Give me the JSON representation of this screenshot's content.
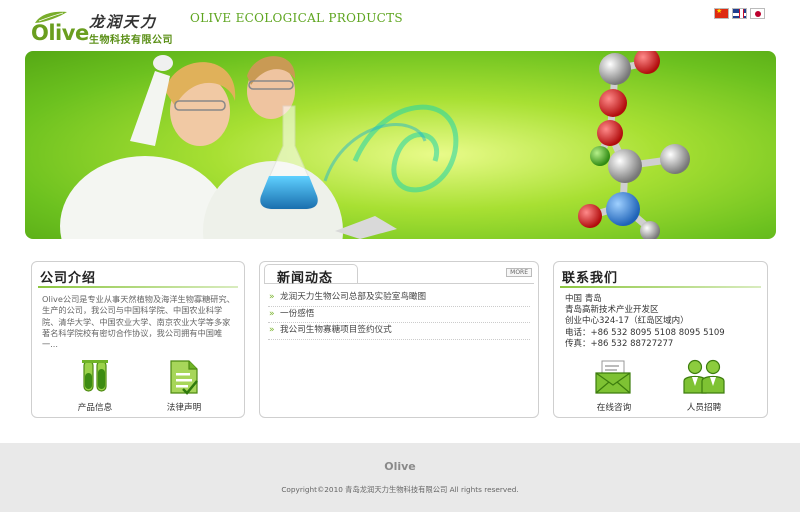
{
  "header": {
    "logo_wordmark": "Olive",
    "logo_cn": "龙润天力",
    "logo_sub": "生物科技有限公司",
    "tagline": "OLIVE ECOLOGICAL PRODUCTS",
    "languages": [
      "zh-CN",
      "en-GB",
      "ja-JP"
    ]
  },
  "colors": {
    "brand_green": "#6a9e1f",
    "accent_green": "#8cc63f",
    "banner_green": "#a8e033",
    "footer_bg": "#e9e9e9"
  },
  "about": {
    "title": "公司介绍",
    "text": "Olive公司是专业从事天然植物及海洋生物寡糖研究、生产的公司，我公司与中国科学院、中国农业科学院、清华大学、中国农业大学、南京农业大学等多家著名科学院校有密切合作协议，我公司拥有中国唯一...",
    "links": [
      {
        "label": "产品信息",
        "icon": "test-tubes-icon"
      },
      {
        "label": "法律声明",
        "icon": "document-icon"
      }
    ]
  },
  "news": {
    "title": "新闻动态",
    "more_label": "MORE",
    "items": [
      "龙润天力生物公司总部及实验室鸟瞰图",
      "一份感悟",
      "我公司生物寡糖项目签约仪式"
    ]
  },
  "contact": {
    "title": "联系我们",
    "lines": [
      "中国  青岛",
      "青岛高新技术产业开发区",
      "创业中心324-17（红岛区域内）",
      "电话：+86 532 8095 5108 8095 5109",
      "传真：+86 532 88727277"
    ],
    "links": [
      {
        "label": "在线咨询",
        "icon": "envelope-icon"
      },
      {
        "label": "人员招聘",
        "icon": "people-icon"
      }
    ]
  },
  "footer": {
    "logo": "Olive",
    "copyright": "Copyright©2010 青岛龙润天力生物科技有限公司  All rights reserved."
  }
}
